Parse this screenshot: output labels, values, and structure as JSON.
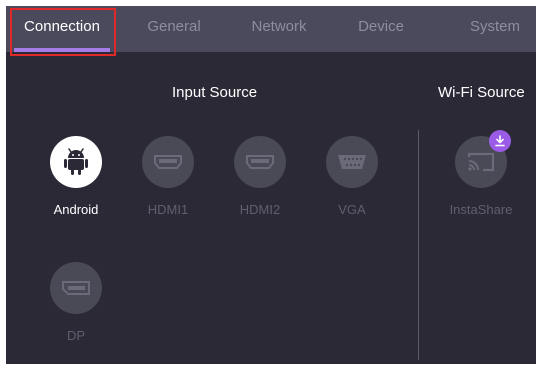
{
  "tabs": [
    {
      "label": "Connection"
    },
    {
      "label": "General"
    },
    {
      "label": "Network"
    },
    {
      "label": "Device"
    },
    {
      "label": "System"
    }
  ],
  "sections": {
    "input_source": "Input Source",
    "wifi_source": "Wi-Fi Source"
  },
  "sources": [
    {
      "label": "Android",
      "icon": "android-icon",
      "selected": true
    },
    {
      "label": "HDMI1",
      "icon": "hdmi-port-icon",
      "selected": false
    },
    {
      "label": "HDMI2",
      "icon": "hdmi-port-icon",
      "selected": false
    },
    {
      "label": "VGA",
      "icon": "vga-port-icon",
      "selected": false
    },
    {
      "label": "DP",
      "icon": "displayport-icon",
      "selected": false
    }
  ],
  "wifi_sources": [
    {
      "label": "InstaShare",
      "icon": "cast-icon",
      "badge_icon": "download-icon"
    }
  ],
  "colors": {
    "accent": "#a57be8",
    "highlight_box": "#e02a2a",
    "badge": "#9a5ce6",
    "background": "#2a2935",
    "tab_bar": "#4a4a5c"
  }
}
